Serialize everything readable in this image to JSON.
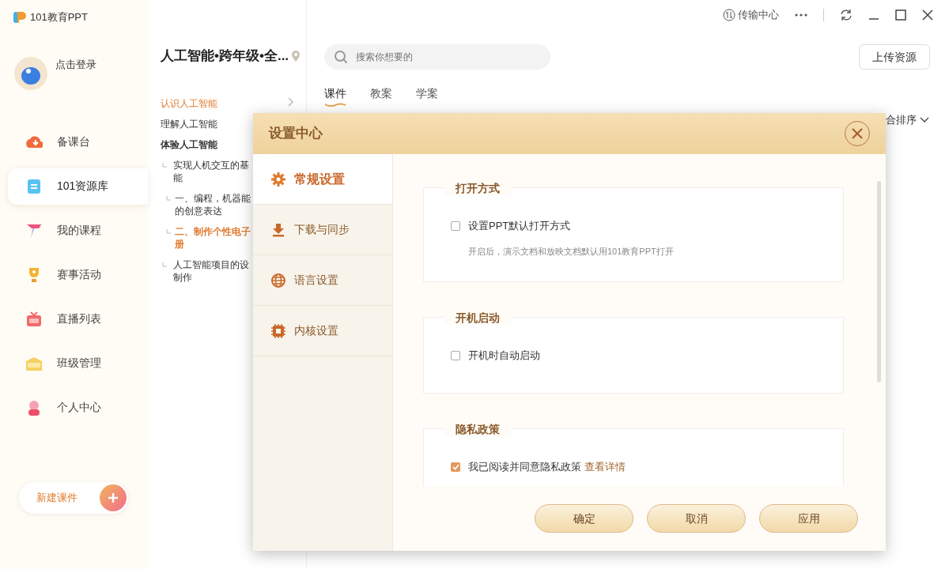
{
  "app": {
    "logo_text": "101教育PPT"
  },
  "user": {
    "login": "点击登录"
  },
  "sidebar": {
    "items": [
      {
        "label": "备课台",
        "selected": false
      },
      {
        "label": "101资源库",
        "selected": true
      },
      {
        "label": "我的课程",
        "selected": false
      },
      {
        "label": "赛事活动",
        "selected": false
      },
      {
        "label": "直播列表",
        "selected": false
      },
      {
        "label": "班级管理",
        "selected": false
      },
      {
        "label": "个人中心",
        "selected": false
      }
    ]
  },
  "new_button": "新建课件",
  "course": {
    "title": "人工智能•跨年级•全...",
    "chapters": [
      {
        "label": "认识人工智能",
        "selected": true,
        "expanded": false
      },
      {
        "label": "理解人工智能",
        "selected": false,
        "expanded": false
      },
      {
        "label": "体验人工智能",
        "selected": false,
        "expanded": true,
        "children": [
          {
            "label": "实现人机交互的基能",
            "selected": false,
            "children": [
              {
                "label": "一、编程，机器能的创意表达",
                "selected": false
              },
              {
                "label": "二、制作个性电子册",
                "selected": true
              }
            ]
          },
          {
            "label": "人工智能项目的设制作",
            "selected": false
          }
        ]
      }
    ]
  },
  "title_bar": {
    "transfer": "传输中心"
  },
  "main": {
    "search": {
      "placeholder": "搜索你想要的"
    },
    "upload": "上传资源",
    "tabs": [
      {
        "label": "课件",
        "selected": true
      },
      {
        "label": "教案",
        "selected": false
      },
      {
        "label": "学案",
        "selected": false
      }
    ],
    "sort": "合排序"
  },
  "dialog": {
    "title": "设置中心",
    "nav": [
      {
        "label": "常规设置",
        "selected": true
      },
      {
        "label": "下载与同步",
        "selected": false
      },
      {
        "label": "语言设置",
        "selected": false
      },
      {
        "label": "内核设置",
        "selected": false
      }
    ],
    "sections": [
      {
        "title": "打开方式",
        "options": [
          {
            "label": "设置PPT默认打开方式",
            "checked": false,
            "note": "开启后，演示文档和放映文档默认用101教育PPT打开"
          }
        ]
      },
      {
        "title": "开机启动",
        "options": [
          {
            "label": "开机时自动启动",
            "checked": false
          }
        ]
      },
      {
        "title": "隐私政策",
        "options": [
          {
            "label": "我已阅读并同意隐私政策",
            "link": "查看详情",
            "checked": true
          }
        ]
      }
    ],
    "buttons": [
      "确定",
      "取消",
      "应用"
    ]
  }
}
